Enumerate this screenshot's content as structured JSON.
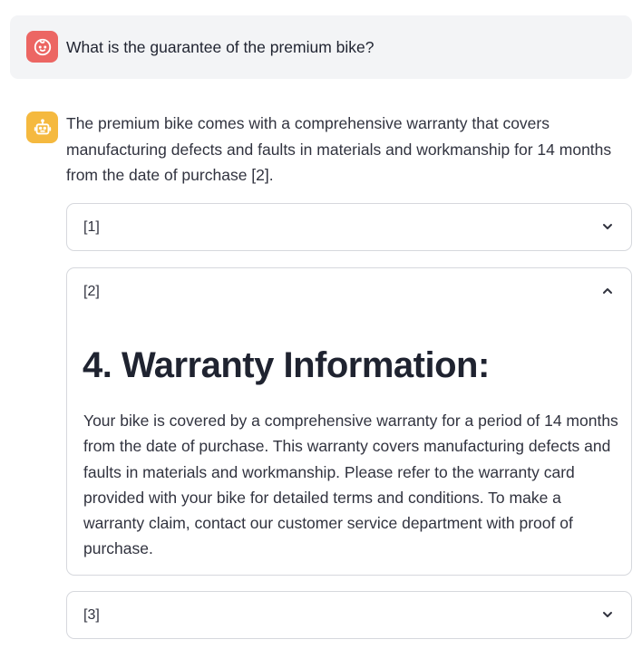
{
  "user": {
    "avatar_icon": "baby-face-icon",
    "message": "What is the guarantee of the premium bike?"
  },
  "assistant": {
    "avatar_icon": "robot-icon",
    "answer": "The premium bike comes with a comprehensive warranty that covers manufacturing defects and faults in materials and workmanship for 14 months from the date of purchase [2]."
  },
  "sources": [
    {
      "label": "[1]",
      "expanded": false,
      "chevron_icon": "chevron-down-icon"
    },
    {
      "label": "[2]",
      "expanded": true,
      "chevron_icon": "chevron-up-icon",
      "title": "4. Warranty Information:",
      "text": "Your bike is covered by a comprehensive warranty for a period of 14 months from the date of purchase. This warranty covers manufacturing defects and faults in materials and workmanship. Please refer to the warranty card provided with your bike for detailed terms and conditions. To make a warranty claim, contact our customer service department with proof of purchase."
    },
    {
      "label": "[3]",
      "expanded": false,
      "chevron_icon": "chevron-down-icon"
    }
  ],
  "colors": {
    "user_avatar": "#ec6663",
    "assistant_avatar": "#f5b93f",
    "user_bubble": "#f3f4f6",
    "border": "#d6d8dd"
  }
}
